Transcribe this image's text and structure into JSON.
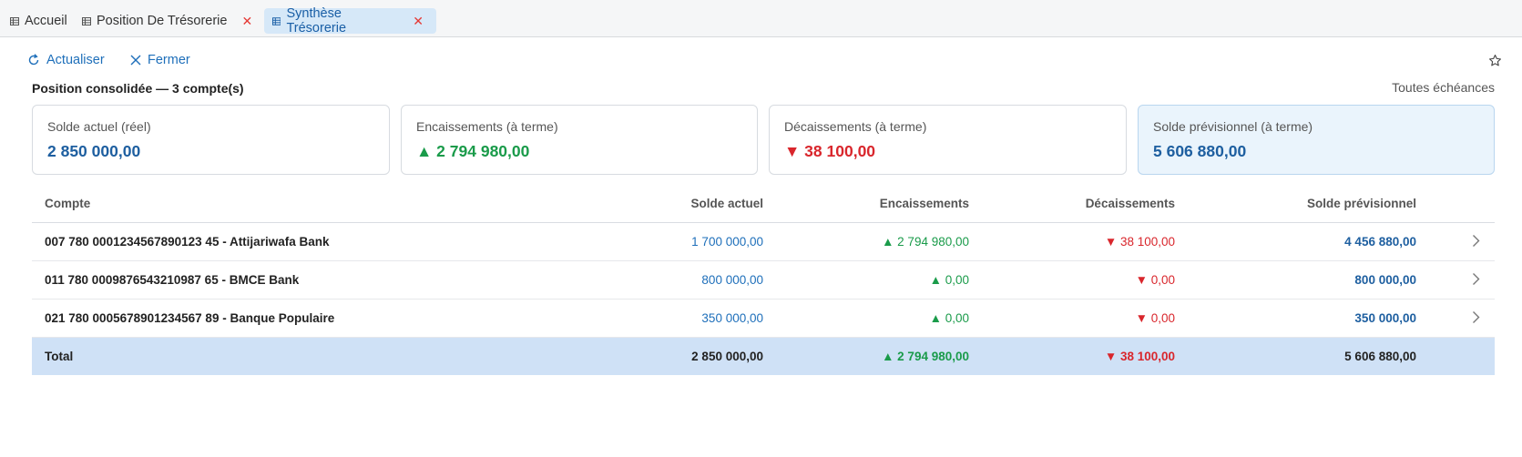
{
  "tabs": [
    {
      "label": "Accueil",
      "closable": false,
      "active": false
    },
    {
      "label": "Position De Trésorerie",
      "closable": true,
      "active": false
    },
    {
      "label": "Synthèse Trésorerie",
      "closable": true,
      "active": true
    }
  ],
  "toolbar": {
    "refresh_label": "Actualiser",
    "close_label": "Fermer"
  },
  "summary": {
    "title": "Position consolidée — 3 compte(s)",
    "echeance_filter": "Toutes échéances"
  },
  "cards": [
    {
      "label": "Solde actuel (réel)",
      "value": "2 850 000,00",
      "color": "#1e5fa0"
    },
    {
      "label": "Encaissements (à terme)",
      "value": "▲ 2 794 980,00",
      "color": "#1a9b4a"
    },
    {
      "label": "Décaissements (à terme)",
      "value": "▼ 38 100,00",
      "color": "#d9262c"
    },
    {
      "label": "Solde prévisionnel (à terme)",
      "value": "5 606 880,00",
      "color": "#1e5fa0"
    }
  ],
  "table": {
    "headers": {
      "compte": "Compte",
      "solde": "Solde actuel",
      "encaissements": "Encaissements",
      "decaissements": "Décaissements",
      "previsionnel": "Solde prévisionnel"
    },
    "rows": [
      {
        "compte": "007 780 0001234567890123 45 - Attijariwafa Bank",
        "solde": "1 700 000,00",
        "encaissements": "▲ 2 794 980,00",
        "decaissements": "▼ 38 100,00",
        "previsionnel": "4 456 880,00"
      },
      {
        "compte": "011 780 0009876543210987 65 - BMCE Bank",
        "solde": "800 000,00",
        "encaissements": "▲ 0,00",
        "decaissements": "▼ 0,00",
        "previsionnel": "800 000,00"
      },
      {
        "compte": "021 780 0005678901234567 89 - Banque Populaire",
        "solde": "350 000,00",
        "encaissements": "▲ 0,00",
        "decaissements": "▼ 0,00",
        "previsionnel": "350 000,00"
      }
    ],
    "total": {
      "label": "Total",
      "solde": "2 850 000,00",
      "encaissements": "▲ 2 794 980,00",
      "decaissements": "▼ 38 100,00",
      "previsionnel": "5 606 880,00"
    }
  },
  "colors": {
    "accent": "#1e6fba",
    "positive": "#1a9b4a",
    "negative": "#d9262c",
    "highlight_bg": "#cfe1f6"
  }
}
